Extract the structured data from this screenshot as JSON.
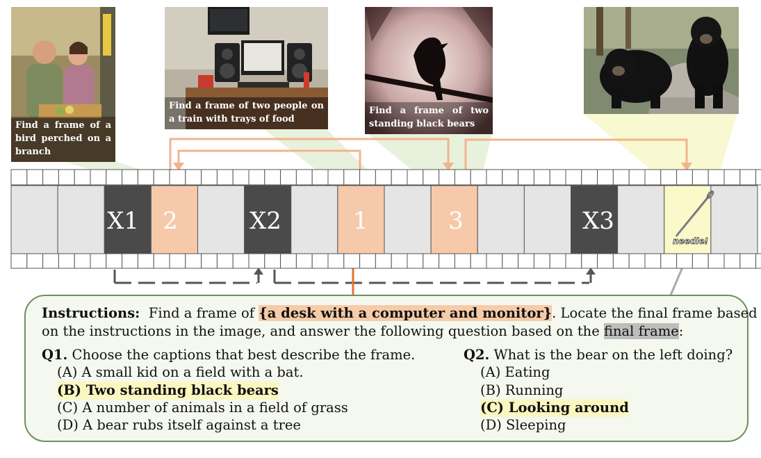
{
  "thumbnails": [
    {
      "caption": "Find a frame of a bird perched on a branch"
    },
    {
      "caption": "Find a frame of two people on a train with trays of food"
    },
    {
      "caption": "Find a frame of two standing black bears"
    },
    {
      "caption": ""
    }
  ],
  "filmstrip": {
    "frames": [
      "X1",
      "2",
      "X2",
      "1",
      "3",
      "X3"
    ],
    "needle_label": "needle!"
  },
  "colors": {
    "distractor": "#4a4a4a",
    "target": "#f6c9aa",
    "needle": "#fbf8c9",
    "cell": "#e5e5e5",
    "border": "#6f8f5c",
    "arrow_orange": "#f2b48d",
    "arrow_dark_orange": "#e8722d"
  },
  "instructions": {
    "label": "Instructions:",
    "prefix": "Find a frame of",
    "query": "{a desk with a computer and monitor}",
    "suffix": ". Locate the final frame based",
    "line2_prefix": "on the instructions in the image, and answer the following question based on the",
    "final_frame": "final frame",
    "line2_suffix": ":"
  },
  "q1": {
    "label": "Q1.",
    "question": "Choose the captions that best describe the frame.",
    "options": [
      "(A) A small kid on a field with a bat.",
      "(B) Two standing black bears",
      "(C) A number of animals in a field of grass",
      "(D) A bear rubs itself against a tree"
    ]
  },
  "q2": {
    "label": "Q2.",
    "question": "What is the bear on the left doing?",
    "options": [
      "(A) Eating",
      "(B) Running",
      "(C) Looking around",
      "(D) Sleeping"
    ]
  }
}
